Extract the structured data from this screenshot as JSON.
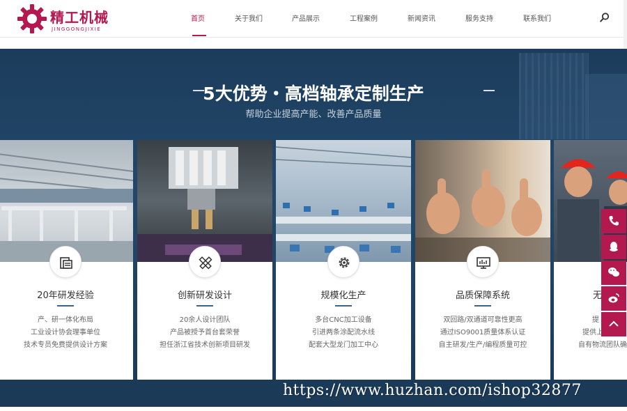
{
  "brand": {
    "name": "精工机械",
    "pinyin": "JINGGONGJIXIE",
    "color": "#b3184e"
  },
  "nav": {
    "items": [
      {
        "label": "首页",
        "active": true
      },
      {
        "label": "关于我们",
        "active": false
      },
      {
        "label": "产品展示",
        "active": false
      },
      {
        "label": "工程案例",
        "active": false
      },
      {
        "label": "新闻资讯",
        "active": false
      },
      {
        "label": "服务支持",
        "active": false
      },
      {
        "label": "联系我们",
        "active": false
      }
    ],
    "search_icon": "search-icon"
  },
  "banner": {
    "title": "5大优势・高档轴承定制生产",
    "subtitle": "帮助企业提高产能、改善产品质量"
  },
  "cards": [
    {
      "title": "20年研发经验",
      "icon": "document-icon",
      "lines": [
        "产、研一体化布局",
        "工业设计协会理事单位",
        "技术专员免费提供设计方案"
      ]
    },
    {
      "title": "创新研发设计",
      "icon": "pencil-ruler-icon",
      "lines": [
        "20余人设计团队",
        "产品被授予首台套荣誉",
        "担任浙江省技术创新项目研发"
      ]
    },
    {
      "title": "规模化生产",
      "icon": "gear-icon",
      "lines": [
        "多台CNC加工设备",
        "引进两条涂配流水线",
        "配套大型龙门加工中心"
      ]
    },
    {
      "title": "品质保障系统",
      "icon": "monitor-chart-icon",
      "lines": [
        "双回路/双通道可靠性更高",
        "通过ISO9001质量体系认证",
        "自主研发/生产/编程质量可控"
      ]
    },
    {
      "title": "无",
      "icon": "",
      "lines": [
        "提",
        "提供上",
        "自有物流团队确"
      ]
    }
  ],
  "float_bar": [
    "phone-icon",
    "qq-icon",
    "wechat-icon",
    "weibo-icon",
    "back-to-top-icon"
  ],
  "watermark": "https://www.huzhan.com/ishop32877"
}
